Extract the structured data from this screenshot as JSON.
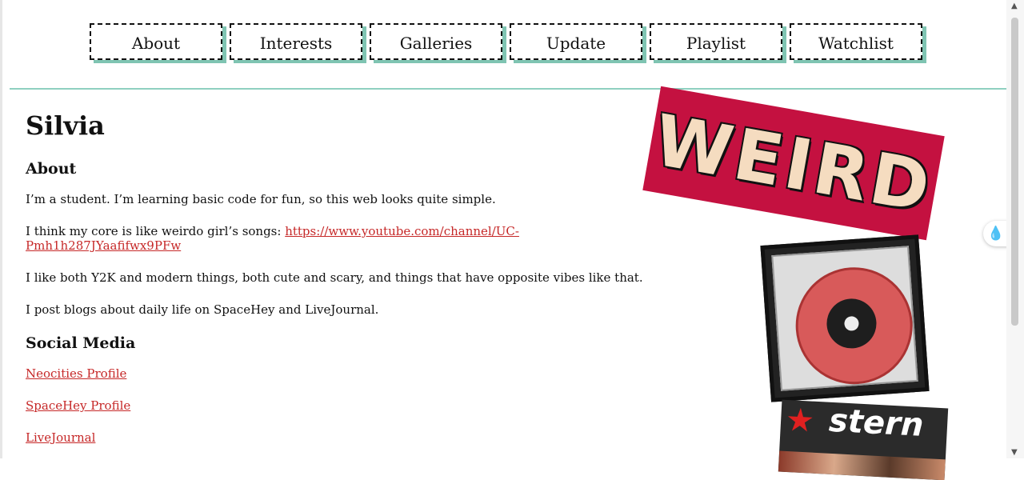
{
  "nav": {
    "items": [
      "About",
      "Interests",
      "Galleries",
      "Update",
      "Playlist",
      "Watchlist"
    ]
  },
  "profile": {
    "name": "Silvia",
    "about_heading": "About",
    "about_p1": "I’m a student. I’m learning basic code for fun, so this web looks quite simple.",
    "about_p2_text": "I think my core is like weirdo girl’s songs: ",
    "about_p2_link": "https://www.youtube.com/channel/UC-Pmh1h287JYaafifwx9PFw",
    "about_p3": "I like both Y2K and modern things, both cute and scary, and things that have opposite vibes like that.",
    "about_p4": "I post blogs about daily life on SpaceHey and LiveJournal.",
    "social_heading": "Social Media",
    "social_links": [
      "Neocities Profile",
      "SpaceHey Profile",
      "LiveJournal"
    ]
  },
  "images": {
    "weird_text": "WEIRD",
    "magazine_title": "stern"
  },
  "colors": {
    "accent": "#8fd0c0",
    "link": "#c62828",
    "sticker_bg": "#c41140"
  }
}
